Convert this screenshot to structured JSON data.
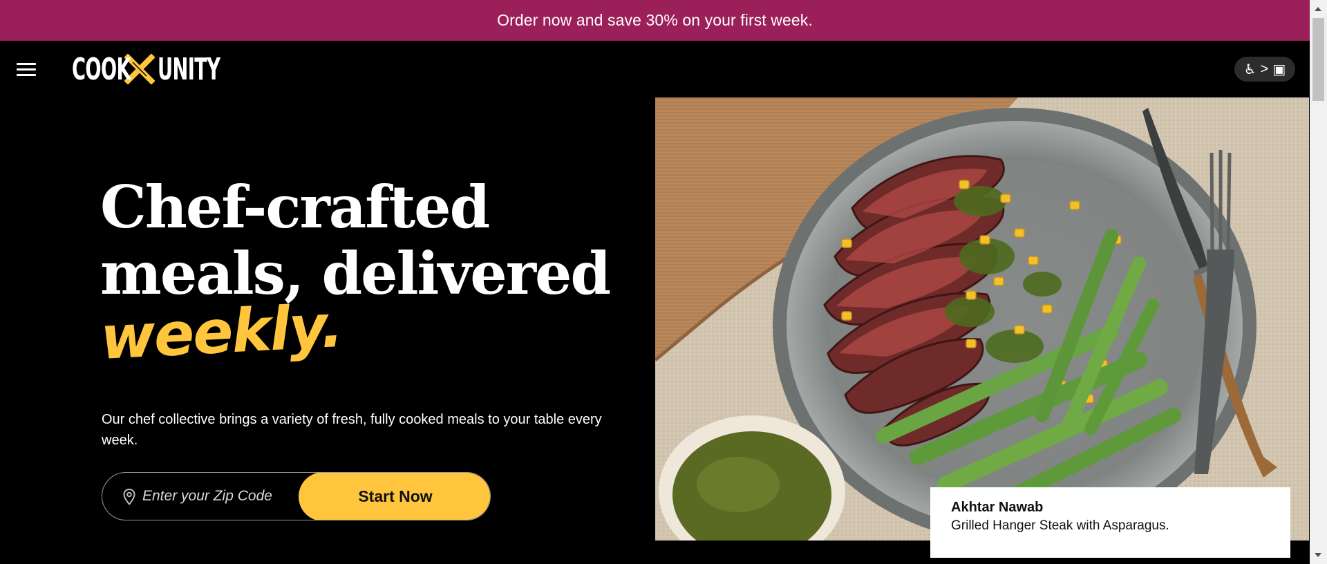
{
  "promo_banner": {
    "text": "Order now and save 30% on your first week."
  },
  "header": {
    "menu_icon": "hamburger-menu-icon",
    "logo": {
      "left": "COOK",
      "right": "UNITY",
      "mark_color": "#ffc53d"
    },
    "accessibility": {
      "wheelchair": "♿",
      "separator": ">",
      "device": "▣"
    }
  },
  "hero": {
    "title_line1": "Chef-crafted",
    "title_line2": "meals, delivered",
    "title_accent": "weekly.",
    "subtitle": "Our chef collective brings a variety of fresh, fully cooked meals to your table every week.",
    "zip_placeholder": "Enter your Zip Code",
    "cta_label": "Start Now"
  },
  "photo_caption": {
    "chef": "Akhtar Nawab",
    "dish": "Grilled Hanger Steak with Asparagus."
  },
  "colors": {
    "promo_bg": "#9b1f58",
    "accent_yellow": "#ffc53d",
    "background": "#000000"
  }
}
